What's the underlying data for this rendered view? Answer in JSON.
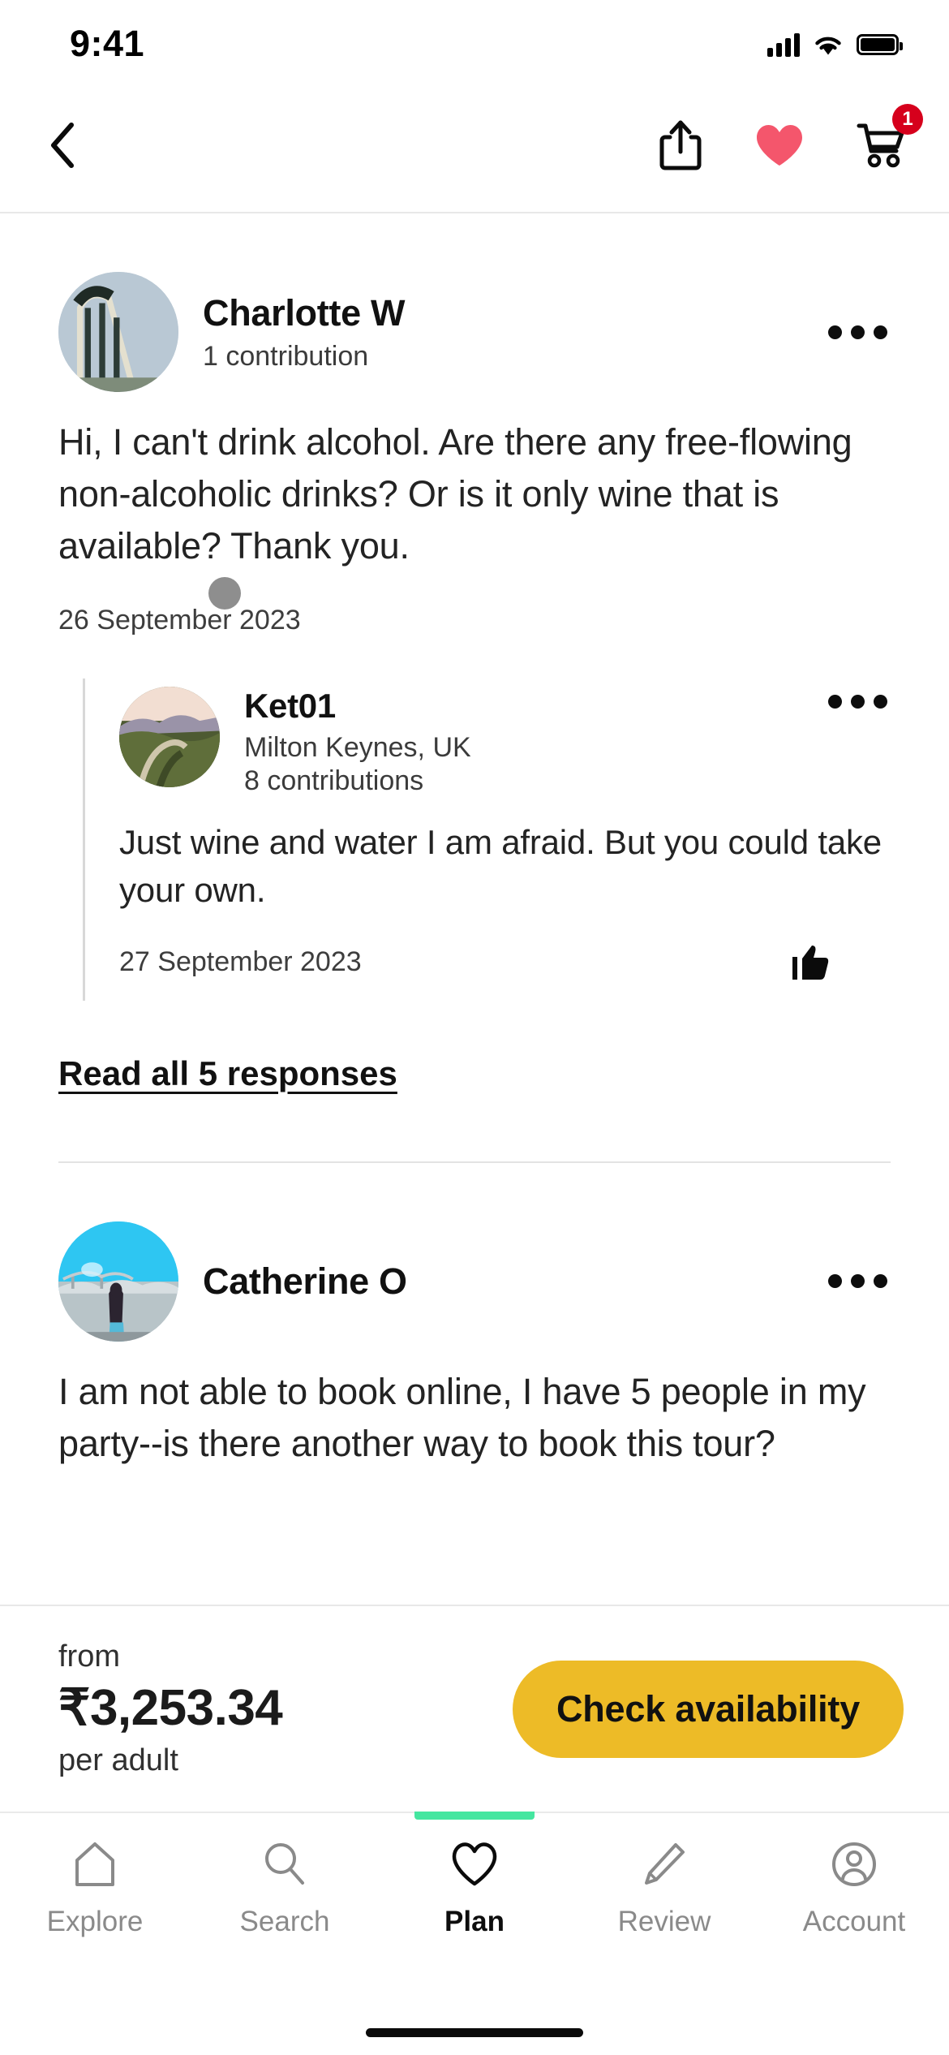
{
  "status_bar": {
    "time": "9:41",
    "signal_icon": "cellular-bars-icon",
    "wifi_icon": "wifi-icon",
    "battery_icon": "battery-full-icon"
  },
  "nav_bar": {
    "back_icon": "chevron-left-icon",
    "share_icon": "share-icon",
    "wishlist_icon": "heart-filled-icon",
    "cart_icon": "shopping-cart-icon",
    "cart_badge": "1",
    "heart_color": "#f4566c",
    "badge_color": "#d6001c"
  },
  "qa": {
    "questions": [
      {
        "author": "Charlotte W",
        "contributions": "1 contribution",
        "avatar_name": "avatar-charlotte-w",
        "menu_icon": "more-options-icon",
        "text": "Hi, I can't drink alcohol. Are there any free-flowing non-alcoholic drinks? Or is it only wine that is available? Thank you.",
        "date": "26 September 2023",
        "reply": {
          "author": "Ket01",
          "location": "Milton Keynes, UK",
          "contributions": "8 contributions",
          "avatar_name": "avatar-ket01",
          "menu_icon": "more-options-icon",
          "text": "Just wine and water I am afraid. But you could take your own.",
          "date": "27 September 2023",
          "helpful_icon": "thumbs-up-icon"
        },
        "read_all_label": "Read all 5 responses"
      },
      {
        "author": "Catherine O",
        "avatar_name": "avatar-catherine-o",
        "menu_icon": "more-options-icon",
        "text": "I am not able to book online, I have 5 people in my party--is there another way to book this tour?"
      }
    ]
  },
  "price_bar": {
    "from_label": "from",
    "price": "₹3,253.34",
    "per_label": "per adult",
    "cta_label": "Check availability",
    "cta_color": "#edbb27"
  },
  "tab_bar": {
    "active_indicator_color": "#45e6a0",
    "items": [
      {
        "label": "Explore",
        "icon": "home-icon",
        "active": false
      },
      {
        "label": "Search",
        "icon": "search-icon",
        "active": false
      },
      {
        "label": "Plan",
        "icon": "heart-outline-icon",
        "active": true
      },
      {
        "label": "Review",
        "icon": "pencil-icon",
        "active": false
      },
      {
        "label": "Account",
        "icon": "account-circle-icon",
        "active": false
      }
    ]
  }
}
